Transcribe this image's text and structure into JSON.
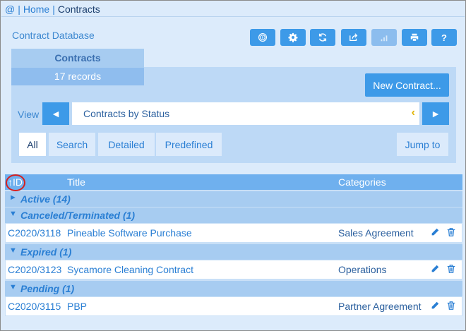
{
  "breadcrumb": {
    "root_icon": "@",
    "sep1": "|",
    "home": "Home",
    "sep2": "|",
    "current": "Contracts"
  },
  "database_title": "Contract Database",
  "toolbar": {
    "buttons": [
      {
        "icon": "fingerprint-icon",
        "enabled": true
      },
      {
        "icon": "gear-icon",
        "enabled": true
      },
      {
        "icon": "refresh-icon",
        "enabled": true
      },
      {
        "icon": "export-icon",
        "enabled": true
      },
      {
        "icon": "chart-icon",
        "enabled": false
      },
      {
        "icon": "print-icon",
        "enabled": true
      },
      {
        "icon": "help-icon",
        "label": "?",
        "enabled": true
      }
    ]
  },
  "tab": {
    "title": "Contracts",
    "records": "17 records"
  },
  "new_contract_label": "New Contract...",
  "view": {
    "label": "View",
    "selected": "Contracts by Status",
    "prev": "◄",
    "next": "►"
  },
  "filter_tabs": [
    "All",
    "Search",
    "Detailed",
    "Predefined"
  ],
  "active_filter": "All",
  "jump_label": "Jump to",
  "table": {
    "headers": {
      "id": "↑ID",
      "title": "Title",
      "categories": "Categories"
    },
    "groups": [
      {
        "arrow": "►",
        "label": "Active (14)",
        "rows": []
      },
      {
        "arrow": "▼",
        "label": "Canceled/Terminated (1)",
        "rows": [
          {
            "id": "C2020/3118",
            "title": "Pineable Software Purchase",
            "category": "Sales Agreement"
          }
        ]
      },
      {
        "arrow": "▼",
        "label": "Expired (1)",
        "rows": [
          {
            "id": "C2020/3123",
            "title": "Sycamore Cleaning Contract",
            "category": "Operations"
          }
        ]
      },
      {
        "arrow": "▼",
        "label": "Pending (1)",
        "rows": [
          {
            "id": "C2020/3115",
            "title": "PBP",
            "category": "Partner Agreement"
          }
        ]
      }
    ]
  },
  "colors": {
    "accent": "#3d9ae8",
    "header": "#6fb0ee",
    "group": "#a7ccf1",
    "background": "#dcebfb",
    "sort_highlight": "#d42020"
  }
}
